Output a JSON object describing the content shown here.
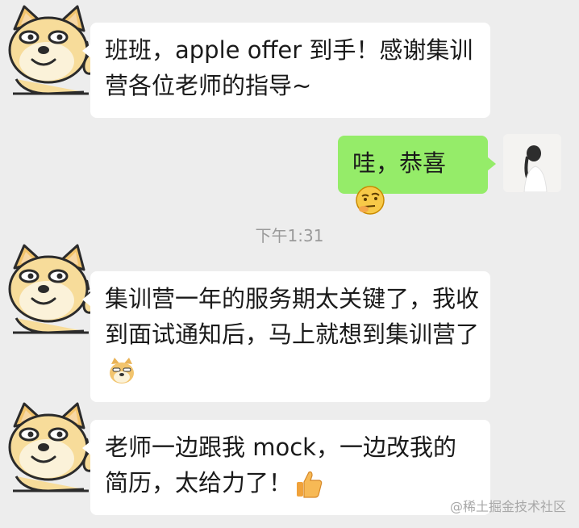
{
  "messages": [
    {
      "sender": "other",
      "text": "班班，apple offer 到手！感谢集训营各位老师的指导~"
    },
    {
      "sender": "self",
      "text": "哇，恭喜",
      "emoji": "thinking-face-emoji"
    },
    {
      "sender": "other",
      "text": "集训营一年的服务期太关键了，我收到面试通知后，马上就想到集训营了",
      "emoji": "doge-emoji"
    },
    {
      "sender": "other",
      "text": "老师一边跟我 mock，一边改我的简历，太给力了！",
      "emoji": "thumbs-up-emoji"
    }
  ],
  "timestamp": "下午1:31",
  "watermark": "@稀土掘金技术社区",
  "colors": {
    "background": "#ededed",
    "self_bubble": "#95ec69",
    "other_bubble": "#ffffff",
    "timestamp": "#9a9a9a"
  }
}
